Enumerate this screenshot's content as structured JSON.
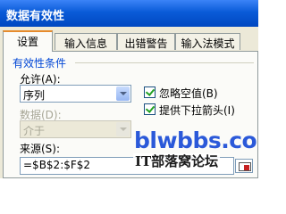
{
  "dialog": {
    "title": "数据有效性"
  },
  "tabs": [
    {
      "label": "设置",
      "active": true
    },
    {
      "label": "输入信息",
      "active": false
    },
    {
      "label": "出错警告",
      "active": false
    },
    {
      "label": "输入法模式",
      "active": false
    }
  ],
  "criteria": {
    "group_label": "有效性条件",
    "allow_label": "允许(A):",
    "allow_value": "序列",
    "data_label": "数据(D):",
    "data_value": "介于",
    "ignore_blank": {
      "label": "忽略空值(B)",
      "checked": true
    },
    "dropdown": {
      "label": "提供下拉箭头(I)",
      "checked": true
    },
    "source_label": "来源(S):",
    "source_value": "=$B$2:$F$2"
  },
  "watermark": {
    "site": "blwbbs.com",
    "name": "IT部落窝论坛"
  },
  "colors": {
    "titlebar": "#0a5bd8",
    "group_label": "#0046d5",
    "watermark_site": "#2b59d9"
  },
  "icons": [
    "dropdown-arrow-icon",
    "checkmark-icon",
    "range-selector-icon"
  ]
}
